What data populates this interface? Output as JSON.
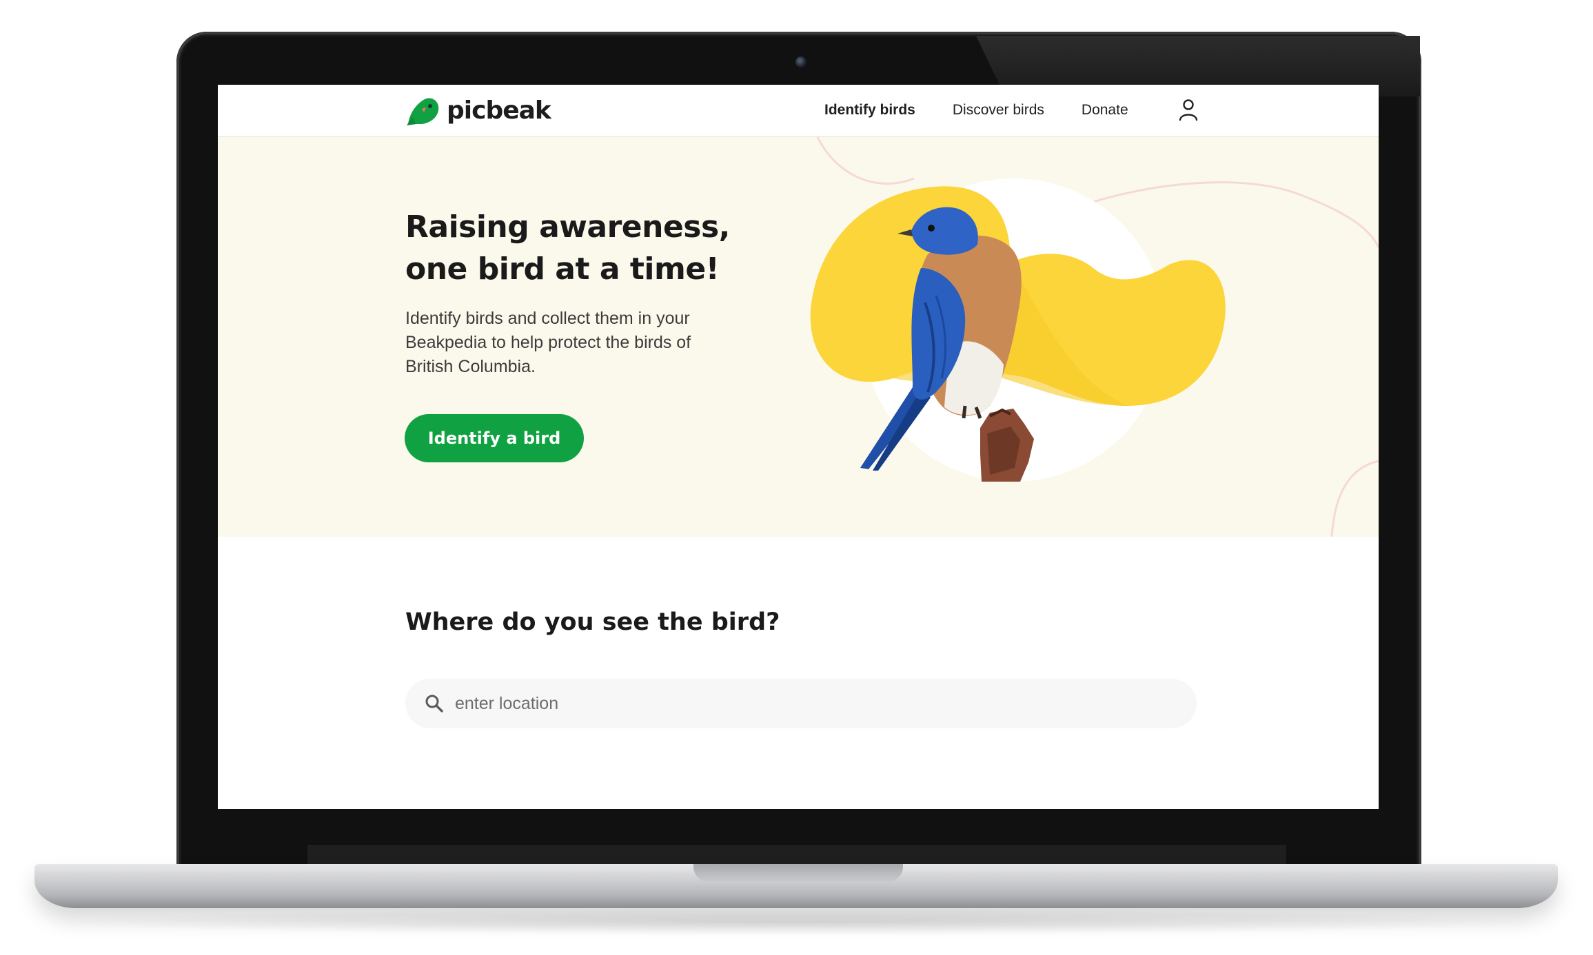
{
  "brand": {
    "name": "picbeak",
    "color": "#10a142"
  },
  "nav": {
    "items": [
      {
        "label": "Identify birds",
        "active": true
      },
      {
        "label": "Discover birds",
        "active": false
      },
      {
        "label": "Donate",
        "active": false
      }
    ],
    "account_icon": "user-icon"
  },
  "hero": {
    "title_line1": "Raising awareness,",
    "title_line2": "one bird at a time!",
    "description": "Identify birds and collect them in your Beakpedia to help protect the birds of British Columbia.",
    "cta_label": "Identify a bird",
    "image": "eastern-bluebird-on-perch",
    "background_color": "#fbf9ec",
    "blob_color": "#fcd53a"
  },
  "location": {
    "heading": "Where do you see the bird?",
    "search_placeholder": "enter location",
    "search_value": "",
    "icon": "search-icon"
  }
}
